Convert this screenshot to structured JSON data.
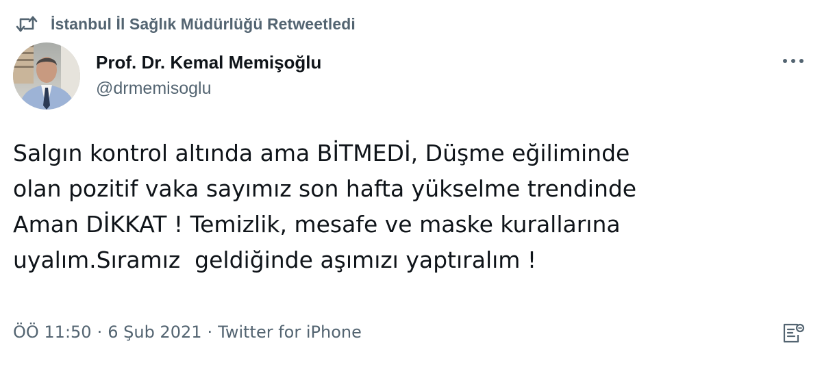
{
  "retweet": {
    "icon": "retweet-icon",
    "text": "İstanbul İl Sağlık Müdürlüğü Retweetledi"
  },
  "author": {
    "name": "Prof. Dr. Kemal Memişoğlu",
    "handle": "@drmemisoglu"
  },
  "more_icon": "more-dots-icon",
  "tweet": {
    "text": "Salgın kontrol altında ama BİTMEDİ, Düşme eğiliminde\nolan pozitif vaka sayımız son hafta yükselme trendinde\nAman DİKKAT ! Temizlik, mesafe ve maske kurallarına\nuyalım.Sıramız  geldiğinde aşımızı yaptıralım !"
  },
  "meta": {
    "time": "ÖÖ 11:50",
    "separator": "·",
    "date": "6 Şub 2021",
    "source": "Twitter for iPhone"
  },
  "analytics_icon": "analytics-icon",
  "colors": {
    "text_primary": "#0f1419",
    "text_secondary": "#536471",
    "background": "#ffffff"
  }
}
